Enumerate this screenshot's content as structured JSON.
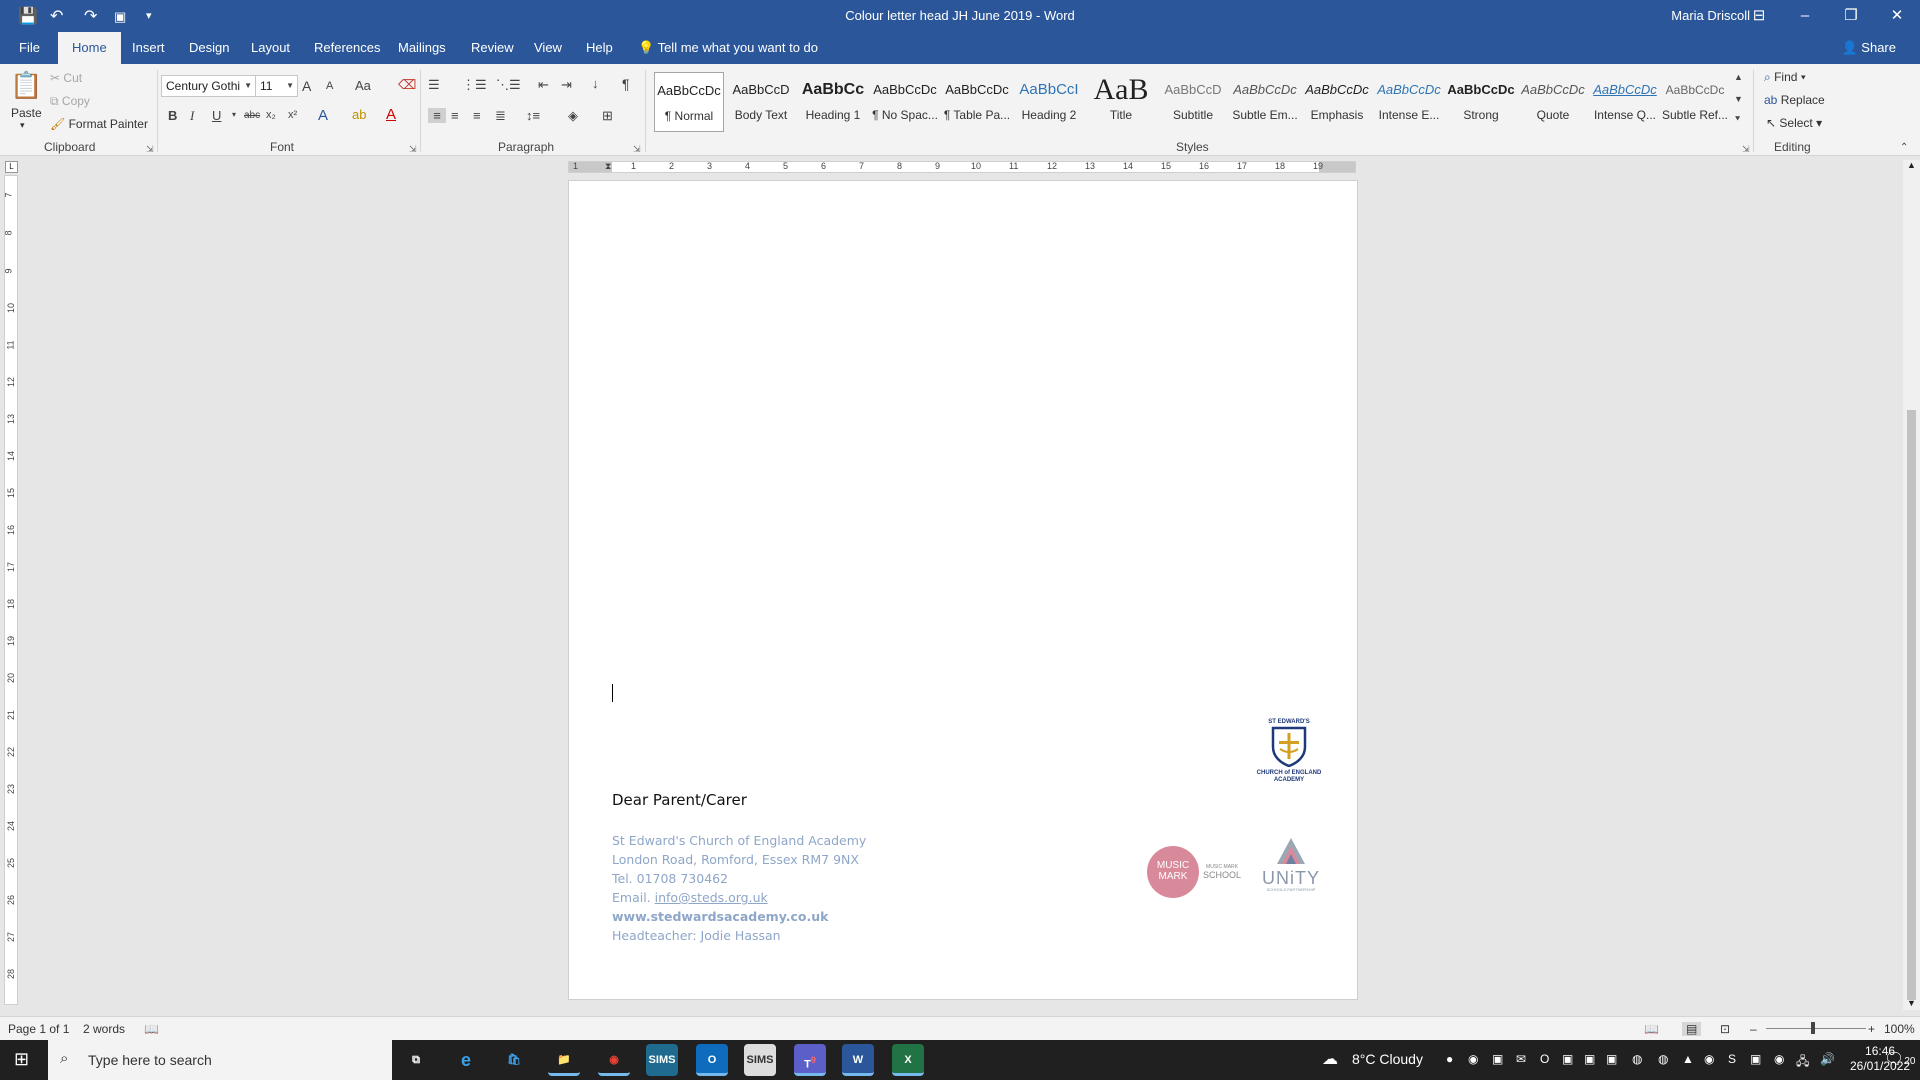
{
  "titlebar": {
    "doc_title": "Colour letter head JH June 2019  -  Word",
    "user": "Maria Driscoll",
    "qa_save": "💾",
    "qa_undo": "↶",
    "qa_redo": "↷",
    "qa_customize": "▾"
  },
  "tabs": [
    "File",
    "Home",
    "Insert",
    "Design",
    "Layout",
    "References",
    "Mailings",
    "Review",
    "View",
    "Help"
  ],
  "tell_me": "Tell me what you want to do",
  "share": "Share",
  "clipboard": {
    "paste": "Paste",
    "cut": "Cut",
    "copy": "Copy",
    "format_painter": "Format Painter",
    "label": "Clipboard"
  },
  "font": {
    "family": "Century Gothi",
    "size": "11",
    "bold": "B",
    "italic": "I",
    "underline": "U",
    "strike": "abc",
    "subscript": "x₂",
    "superscript": "x²",
    "grow": "A",
    "shrink": "A",
    "change_case": "Aa",
    "label": "Font"
  },
  "paragraph": {
    "label": "Paragraph",
    "pilcrow": "¶"
  },
  "styles": {
    "label": "Styles",
    "items": [
      {
        "preview": "AaBbCcDc",
        "name": "¶ Normal"
      },
      {
        "preview": "AaBbCcD",
        "name": "Body Text"
      },
      {
        "preview": "AaBbCc",
        "name": "Heading 1"
      },
      {
        "preview": "AaBbCcDc",
        "name": "¶ No Spac..."
      },
      {
        "preview": "AaBbCcDc",
        "name": "¶ Table Pa..."
      },
      {
        "preview": "AaBbCcI",
        "name": "Heading 2"
      },
      {
        "preview": "AaB",
        "name": "Title"
      },
      {
        "preview": "AaBbCcD",
        "name": "Subtitle"
      },
      {
        "preview": "AaBbCcDc",
        "name": "Subtle Em..."
      },
      {
        "preview": "AaBbCcDc",
        "name": "Emphasis"
      },
      {
        "preview": "AaBbCcDc",
        "name": "Intense E..."
      },
      {
        "preview": "AaBbCcDc",
        "name": "Strong"
      },
      {
        "preview": "AaBbCcDc",
        "name": "Quote"
      },
      {
        "preview": "AaBbCcDc",
        "name": "Intense Q..."
      },
      {
        "preview": "AaBbCcDc",
        "name": "Subtle Ref..."
      }
    ]
  },
  "editing": {
    "label": "Editing",
    "find": "Find",
    "replace": "Replace",
    "select": "Select"
  },
  "ruler": {
    "h": [
      "1",
      "1",
      "2",
      "3",
      "4",
      "5",
      "6",
      "7",
      "8",
      "9",
      "10",
      "11",
      "12",
      "13",
      "14",
      "15",
      "16",
      "17",
      "18",
      "19"
    ],
    "v": [
      "7",
      "8",
      "9",
      "10",
      "11",
      "12",
      "13",
      "14",
      "15",
      "16",
      "17",
      "18",
      "19",
      "20",
      "21",
      "22",
      "23",
      "24",
      "25",
      "26",
      "27",
      "28"
    ]
  },
  "document": {
    "greeting": "Dear Parent/Carer",
    "address": [
      "St Edward's Church of England Academy",
      "London Road, Romford, Essex RM7 9NX",
      "Tel. 01708 730462"
    ],
    "email_prefix": "Email. ",
    "email": "info@steds.org.uk",
    "website": "www.stedwardsacademy.co.uk",
    "headteacher": "Headteacher: Jodie Hassan",
    "crest_top": "ST EDWARD'S",
    "crest_bottom1": "CHURCH of ENGLAND",
    "crest_bottom2": "ACADEMY",
    "music_mark_1": "MUSIC",
    "music_mark_2": "MARK",
    "music_mark_school_1": "MUSIC MARK",
    "music_mark_school_2": "SCHOOL",
    "unity": "UNiTY",
    "unity_sub": "SCHOOLS PARTNERSHIP"
  },
  "status": {
    "page": "Page 1 of 1",
    "words": "2 words",
    "zoom": "100%"
  },
  "taskbar": {
    "search_placeholder": "Type here to search",
    "weather": "8°C  Cloudy",
    "time": "16:46",
    "date": "26/01/2022",
    "notifications": "20",
    "sims_label": "SIMS",
    "teams_badge": "9"
  },
  "colors": {
    "word_blue": "#2b579a",
    "address_text": "#8ea6c8",
    "music_mark_pink": "#d98a9a"
  }
}
